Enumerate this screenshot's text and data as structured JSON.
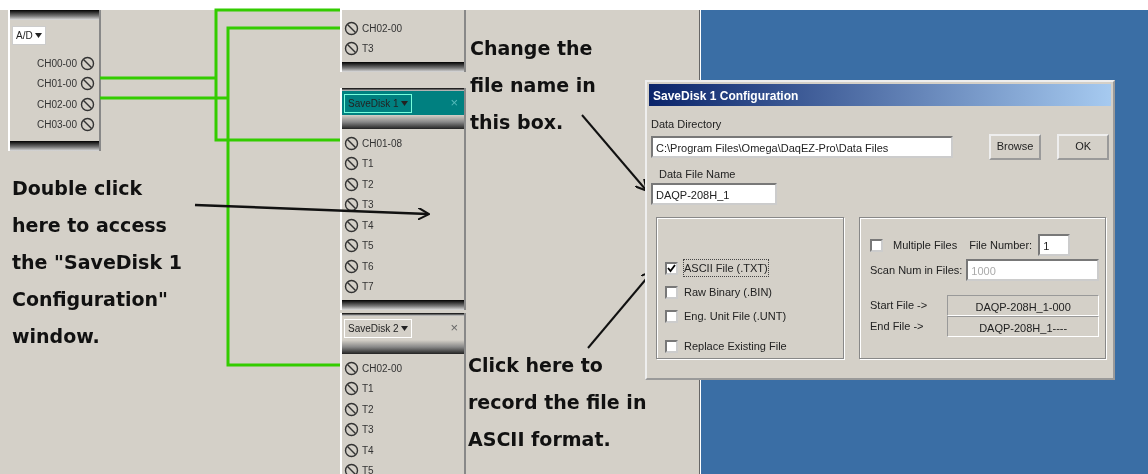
{
  "canvas": {
    "blocks": [
      {
        "kind": "source",
        "dropdown": "A/D",
        "channels": [
          "CH00-00",
          "CH01-00",
          "CH02-00",
          "CH03-00"
        ]
      },
      {
        "kind": "partial",
        "channels": [
          "CH02-00",
          "T3"
        ]
      },
      {
        "kind": "sink",
        "title": "SaveDisk 1",
        "selected": true,
        "close": "×",
        "channels": [
          "CH01-08",
          "T1",
          "T2",
          "T3",
          "T4",
          "T5",
          "T6",
          "T7"
        ]
      },
      {
        "kind": "sink",
        "title": "SaveDisk 2",
        "selected": false,
        "close": "×",
        "channels": [
          "CH02-00",
          "T1",
          "T2",
          "T3",
          "T4",
          "T5"
        ]
      }
    ]
  },
  "annotations": [
    {
      "text": "Change the\nfile name in\nthis box."
    },
    {
      "text": "Double click\nhere to access\nthe \"SaveDisk 1\nConfiguration\"\nwindow."
    },
    {
      "text": "Click here to\nrecord the file in\nASCII format."
    }
  ],
  "dialog": {
    "title": "SaveDisk 1 Configuration",
    "directory_label": "Data Directory",
    "directory": "C:\\Program Files\\Omega\\DaqEZ-Pro\\Data Files",
    "buttons": [
      "Browse",
      "OK"
    ],
    "file_name_label": "Data File Name",
    "file_name": "DAQP-208H_1",
    "format_options": [
      {
        "label": "ASCII File (.TXT)",
        "checked": true
      },
      {
        "label": "Raw Binary (.BIN)",
        "checked": false
      },
      {
        "label": "Eng. Unit File (.UNT)",
        "checked": false
      },
      {
        "label": "Replace Existing File",
        "checked": false
      }
    ],
    "multiple_files": {
      "label": "Multiple Files",
      "checked": false
    },
    "file_number_label": "File Number:",
    "file_number": "1",
    "scan_label": "Scan Num in Files:",
    "scan_value": "1000",
    "scan_disabled": true,
    "start_label": "Start File ->",
    "start_file": "DAQP-208H_1-000",
    "end_label": "End File ->",
    "end_file": "DAQP-208H_1----"
  }
}
